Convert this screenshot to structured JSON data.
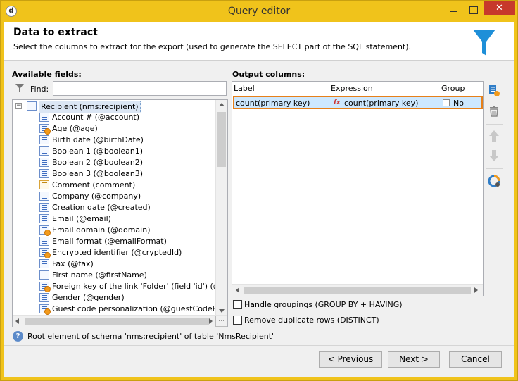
{
  "window": {
    "title": "Query editor",
    "close_glyph": "✕",
    "app_icon_glyph": "d"
  },
  "header": {
    "title": "Data to extract",
    "subtitle": "Select the columns to extract for the export (used to generate the SELECT part of the SQL statement).",
    "icon": "funnel-icon",
    "icon_color": "#1e8fd8"
  },
  "available": {
    "label": "Available fields:",
    "find_label": "Find:",
    "find_value": "",
    "tree": {
      "root": {
        "label": "Recipient (nms:recipient)",
        "expander": "⊟"
      },
      "items": [
        {
          "label": "Account # (@account)",
          "icon": "field"
        },
        {
          "label": "Age (@age)",
          "icon": "calc"
        },
        {
          "label": "Birth date (@birthDate)",
          "icon": "field"
        },
        {
          "label": "Boolean 1 (@boolean1)",
          "icon": "field"
        },
        {
          "label": "Boolean 2 (@boolean2)",
          "icon": "field"
        },
        {
          "label": "Boolean 3 (@boolean3)",
          "icon": "field"
        },
        {
          "label": "Comment (comment)",
          "icon": "memo"
        },
        {
          "label": "Company (@company)",
          "icon": "field"
        },
        {
          "label": "Creation date (@created)",
          "icon": "field"
        },
        {
          "label": "Email (@email)",
          "icon": "field"
        },
        {
          "label": "Email domain (@domain)",
          "icon": "calc"
        },
        {
          "label": "Email format (@emailFormat)",
          "icon": "field"
        },
        {
          "label": "Encrypted identifier (@cryptedId)",
          "icon": "calc"
        },
        {
          "label": "Fax (@fax)",
          "icon": "field"
        },
        {
          "label": "First name (@firstName)",
          "icon": "field"
        },
        {
          "label": "Foreign key of the link 'Folder' (field 'id') (@f",
          "icon": "calc"
        },
        {
          "label": "Gender (@gender)",
          "icon": "field"
        },
        {
          "label": "Guest code personalization (@guestCodeExp",
          "icon": "calc"
        }
      ]
    },
    "scroll_corner": "⋯"
  },
  "output": {
    "label": "Output columns:",
    "columns": {
      "label": "Label",
      "expression": "Expression",
      "group": "Group"
    },
    "rows": [
      {
        "label": "count(primary key)",
        "fx": "fx",
        "expression": "count(primary key)",
        "group": "No"
      }
    ]
  },
  "options": {
    "handle_groupings": "Handle groupings (GROUP BY + HAVING)",
    "remove_duplicates": "Remove duplicate rows (DISTINCT)"
  },
  "status": {
    "icon_glyph": "?",
    "text": "Root element of schema 'nms:recipient' of table 'NmsRecipient'"
  },
  "buttons": {
    "previous": "< Previous",
    "next": "Next >",
    "cancel": "Cancel"
  },
  "colors": {
    "title_bar": "#f0c31b",
    "selection_highlight": "#e6801a",
    "close_button": "#c7392b"
  }
}
